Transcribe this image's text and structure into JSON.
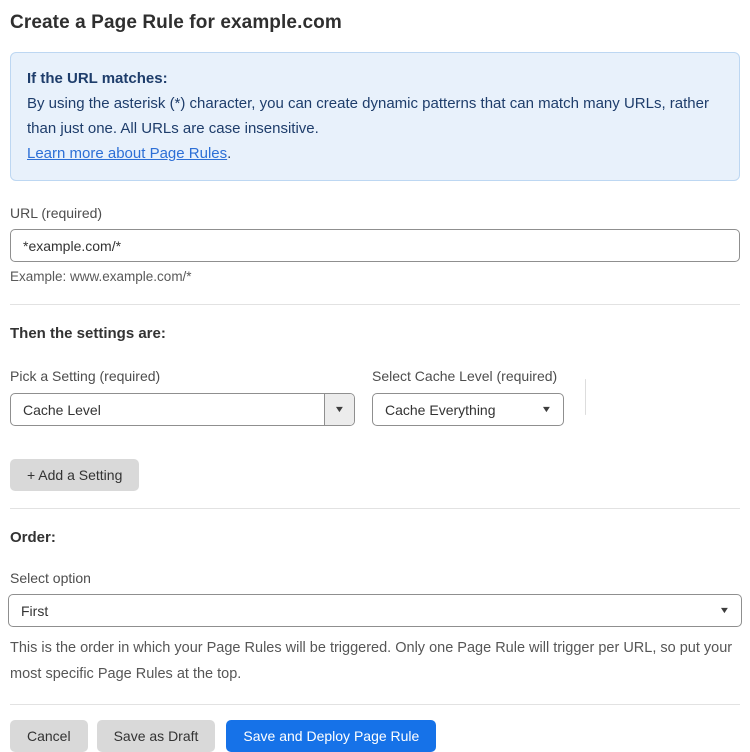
{
  "page": {
    "title": "Create a Page Rule for example.com"
  },
  "info_box": {
    "heading": "If the URL matches:",
    "body": "By using the asterisk (*) character, you can create dynamic patterns that can match many URLs, rather than just one. All URLs are case insensitive.",
    "link_label": "Learn more about Page Rules",
    "link_suffix": "."
  },
  "url_field": {
    "label": "URL (required)",
    "value": "*example.com/*",
    "example": "Example: www.example.com/*"
  },
  "settings": {
    "heading": "Then the settings are:",
    "pick_setting": {
      "label": "Pick a Setting (required)",
      "value": "Cache Level",
      "dropdown_icon": "▼"
    },
    "cache_level": {
      "label": "Select Cache Level (required)",
      "value": "Cache Everything",
      "dropdown_icon": "▼"
    },
    "add_setting_label": "+ Add a Setting"
  },
  "order": {
    "heading": "Order:",
    "select_label": "Select option",
    "value": "First",
    "dropdown_icon": "▼",
    "help_text": "This is the order in which your Page Rules will be triggered. Only one Page Rule will trigger per URL, so put your most specific Page Rules at the top."
  },
  "footer": {
    "cancel_label": "Cancel",
    "save_draft_label": "Save as Draft",
    "save_deploy_label": "Save and Deploy Page Rule"
  },
  "colors": {
    "info_bg": "#e8f1fb",
    "info_border": "#bdd7f2",
    "info_text": "#1e3d6b",
    "link": "#2c6fd6",
    "primary_button": "#1672e8",
    "gray_button": "#d9d9d9"
  }
}
